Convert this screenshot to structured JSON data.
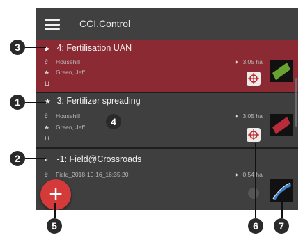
{
  "app": {
    "title": "CCI.Control"
  },
  "jobs": [
    {
      "status_icon": "play-icon",
      "status_glyph": "▶",
      "title": "4: Fertilisation UAN",
      "farm": "Househill",
      "customer": "Green, Jeff",
      "area": "3.05 ha",
      "selected": true,
      "field_color": "#6aa232"
    },
    {
      "status_icon": "star-icon",
      "status_glyph": "★",
      "title": "3: Fertilizer spreading",
      "farm": "Househill",
      "customer": "Green, Jeff",
      "area": "3.05 ha",
      "selected": false,
      "field_color": "#b82b3a"
    },
    {
      "status_icon": "pause-icon",
      "status_glyph": "⏸",
      "title": "-1: Field@Crossroads",
      "farm": "Field_2018-10-16_16:35:20",
      "area": "0.54 ha",
      "selected": false,
      "field_color": "#3a7fd0"
    }
  ],
  "fab": {
    "label": "+"
  },
  "callouts": [
    "1",
    "2",
    "3",
    "4",
    "5",
    "6",
    "7"
  ],
  "colors": {
    "selected_row": "#8c2a33",
    "fab": "#d43a3a",
    "appbar": "#404040"
  }
}
